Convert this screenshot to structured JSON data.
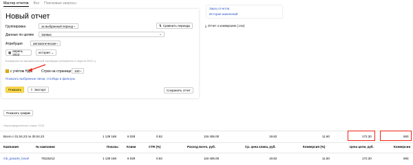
{
  "tabs": [
    {
      "label": "Мастер отчетов",
      "active": true
    },
    {
      "label": "Все"
    },
    {
      "label": "Поисковые запросы"
    }
  ],
  "title": "Новый отчет",
  "group": {
    "label": "Группировка",
    "value": "за выбранный период",
    "compare": "Сравнить периоды"
  },
  "data_by": {
    "label": "Данные по целям",
    "value": "Заявка"
  },
  "attrib": {
    "label": "Атрибуция",
    "value": "автоматическая"
  },
  "date_btn": "апрель 2023",
  "history_btn": "история",
  "conv_note": "Конверсии по автоматической атрибуции (обновлено 5 апреля 2023 г.)",
  "vat": {
    "label": "с учётом НДС",
    "checked": true
  },
  "rows_per_page": {
    "label": "Строк на странице",
    "value": "100"
  },
  "show_link": "Показать выбранные связи, столбцы и фильтры",
  "show_btn": "Показать",
  "export_btn": "Экспорт",
  "save_btn": "Сохранить отчет",
  "side": {
    "link1": "Заказ отчетов",
    "link2": "История изменений",
    "conv_report": "Отчет о конверсиях (.csv)"
  },
  "graph_btn": "Показать график",
  "undistributed": "Нераспределенные клики: 2216",
  "totals": {
    "label": "Всего с 01.04.23 по 30.04.23",
    "shows": "1 139 168",
    "clicks": "6 028",
    "ctr": "0.53",
    "cost": "119 406.00",
    "cpc": "19.82",
    "conv_rate": "11.50",
    "cpa": "172.30",
    "conversions": "693"
  },
  "headers": {
    "campaign": "Кампания",
    "campaign_no": "№ кампании",
    "shows": "Показы",
    "clicks": "Клики",
    "ctr": "CTR (%)",
    "cost": "Расход всего, руб.",
    "cpc": "Ср. цена клика, руб.",
    "conv_rate": "Конверсия (%)",
    "cpa": "Цена цели, руб.",
    "conversions": "Конверсии"
  },
  "row": {
    "campaign": "mb_pasarte_travel",
    "campaign_no": "78115212",
    "shows": "1 139 168",
    "clicks": "6 028",
    "ctr": "0.53",
    "cost": "119 406.00",
    "cpc": "19.82",
    "conv_rate": "11.50",
    "cpa": "172.30",
    "conversions": "693"
  },
  "colors": {
    "accent": "#ffdb4d",
    "link": "#2a56c6",
    "highlight": "#e21"
  }
}
